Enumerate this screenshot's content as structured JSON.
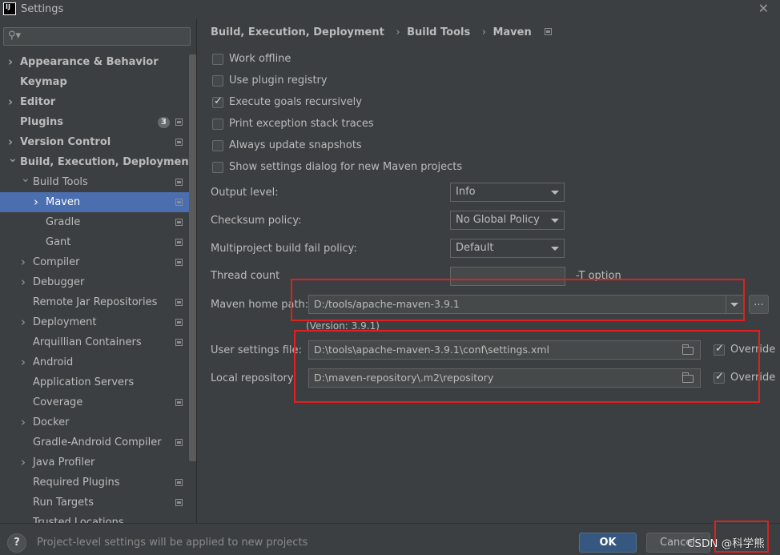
{
  "window": {
    "title": "Settings",
    "close_icon": "close-icon",
    "logo_text": "IJ"
  },
  "search": {
    "placeholder": "",
    "icon": "search-icon"
  },
  "sidebar": {
    "items": [
      {
        "label": "Appearance & Behavior",
        "bold": true,
        "level": 0,
        "arrow": "right"
      },
      {
        "label": "Keymap",
        "bold": true,
        "level": 0,
        "arrow": ""
      },
      {
        "label": "Editor",
        "bold": true,
        "level": 0,
        "arrow": "right"
      },
      {
        "label": "Plugins",
        "bold": true,
        "level": 0,
        "arrow": "",
        "badge": "3",
        "icon": true
      },
      {
        "label": "Version Control",
        "bold": true,
        "level": 0,
        "arrow": "right",
        "icon": true
      },
      {
        "label": "Build, Execution, Deployment",
        "bold": true,
        "level": 0,
        "arrow": "down"
      },
      {
        "label": "Build Tools",
        "bold": false,
        "level": 1,
        "arrow": "down",
        "icon": true
      },
      {
        "label": "Maven",
        "bold": false,
        "level": 2,
        "arrow": "right",
        "icon": true,
        "selected": true
      },
      {
        "label": "Gradle",
        "bold": false,
        "level": 2,
        "arrow": "",
        "icon": true
      },
      {
        "label": "Gant",
        "bold": false,
        "level": 2,
        "arrow": "",
        "icon": true
      },
      {
        "label": "Compiler",
        "bold": false,
        "level": 1,
        "arrow": "right",
        "icon": true
      },
      {
        "label": "Debugger",
        "bold": false,
        "level": 1,
        "arrow": "right"
      },
      {
        "label": "Remote Jar Repositories",
        "bold": false,
        "level": 1,
        "arrow": "",
        "icon": true
      },
      {
        "label": "Deployment",
        "bold": false,
        "level": 1,
        "arrow": "right",
        "icon": true
      },
      {
        "label": "Arquillian Containers",
        "bold": false,
        "level": 1,
        "arrow": "",
        "icon": true
      },
      {
        "label": "Android",
        "bold": false,
        "level": 1,
        "arrow": "right"
      },
      {
        "label": "Application Servers",
        "bold": false,
        "level": 1,
        "arrow": ""
      },
      {
        "label": "Coverage",
        "bold": false,
        "level": 1,
        "arrow": "",
        "icon": true
      },
      {
        "label": "Docker",
        "bold": false,
        "level": 1,
        "arrow": "right"
      },
      {
        "label": "Gradle-Android Compiler",
        "bold": false,
        "level": 1,
        "arrow": "",
        "icon": true
      },
      {
        "label": "Java Profiler",
        "bold": false,
        "level": 1,
        "arrow": "right"
      },
      {
        "label": "Required Plugins",
        "bold": false,
        "level": 1,
        "arrow": "",
        "icon": true
      },
      {
        "label": "Run Targets",
        "bold": false,
        "level": 1,
        "arrow": "",
        "icon": true
      },
      {
        "label": "Trusted Locations",
        "bold": false,
        "level": 1,
        "arrow": ""
      }
    ]
  },
  "breadcrumb": {
    "parts": [
      "Build, Execution, Deployment",
      "Build Tools",
      "Maven"
    ],
    "separator": "›",
    "icon": "project-scope-icon"
  },
  "checkboxes": [
    {
      "label": "Work offline",
      "checked": false
    },
    {
      "label": "Use plugin registry",
      "checked": false
    },
    {
      "label": "Execute goals recursively",
      "checked": true
    },
    {
      "label": "Print exception stack traces",
      "checked": false
    },
    {
      "label": "Always update snapshots",
      "checked": false
    },
    {
      "label": "Show settings dialog for new Maven projects",
      "checked": false
    }
  ],
  "form": {
    "output_level": {
      "label": "Output level:",
      "value": "Info"
    },
    "checksum_policy": {
      "label": "Checksum policy:",
      "value": "No Global Policy"
    },
    "fail_policy": {
      "label": "Multiproject build fail policy:",
      "value": "Default"
    },
    "thread_count": {
      "label": "Thread count",
      "value": "",
      "hint": "-T option"
    },
    "maven_home": {
      "label": "Maven home path:",
      "value": "D:/tools/apache-maven-3.9.1",
      "version": "(Version: 3.9.1)",
      "browse": "..."
    },
    "user_settings": {
      "label": "User settings file:",
      "value": "D:\\tools\\apache-maven-3.9.1\\conf\\settings.xml",
      "override_label": "Override",
      "override_checked": true
    },
    "local_repo": {
      "label": "Local repository:",
      "value": "D:\\maven-repository\\.m2\\repository",
      "override_label": "Override",
      "override_checked": true
    }
  },
  "footer": {
    "help": "?",
    "note": "Project-level settings will be applied to new projects",
    "ok": "OK",
    "cancel": "Cancel"
  },
  "watermark": "CSDN @科学熊",
  "colors": {
    "accent": "#4b6eaf",
    "ok_button": "#365880",
    "highlight": "#e02020",
    "background": "#3c3f41"
  }
}
